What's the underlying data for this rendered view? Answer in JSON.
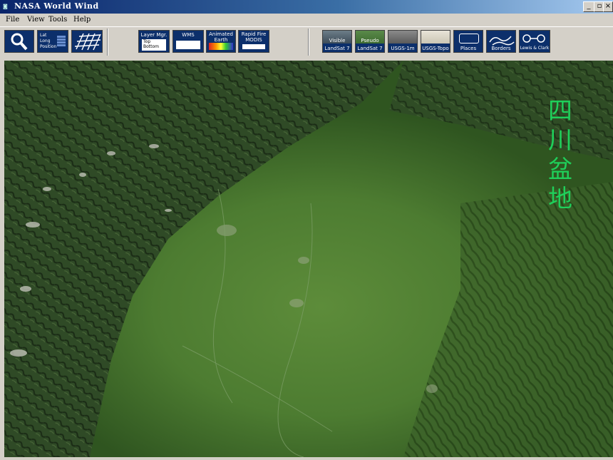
{
  "window": {
    "title": "NASA World Wind",
    "icon": "world-wind-icon",
    "controls": {
      "minimize": "_",
      "restore": "▫",
      "close": "×"
    }
  },
  "menu": {
    "items": [
      "File",
      "View",
      "Tools",
      "Help"
    ]
  },
  "toolbar": {
    "left_tools": [
      {
        "name": "search",
        "icon": "magnifier-icon"
      },
      {
        "name": "position",
        "lines": [
          "Lat",
          "Long",
          "Position"
        ]
      },
      {
        "name": "lat-long-grid",
        "icon": "grid-icon"
      }
    ],
    "layer_mgr": {
      "label": "Layer Mgr.",
      "top": "Top",
      "bottom": "Bottom"
    },
    "wms": {
      "label": "WMS"
    },
    "animated_earth": {
      "label1": "Animated",
      "label2": "Earth"
    },
    "rapid_fire": {
      "label1": "Rapid Fire",
      "label2": "MODIS"
    },
    "layers": [
      {
        "name": "landsat-visible",
        "top": "Visible",
        "label": "LandSat 7"
      },
      {
        "name": "landsat-pseudo",
        "top": "Pseudo",
        "label": "LandSat 7"
      },
      {
        "name": "usgs-1m",
        "top": "",
        "label": "USGS-1m"
      },
      {
        "name": "usgs-topo",
        "top": "",
        "label": "USGS-Topo"
      },
      {
        "name": "places",
        "top": "Places",
        "label": "Places"
      },
      {
        "name": "borders",
        "top": "",
        "label": "Borders"
      },
      {
        "name": "lewis-clark",
        "top": "",
        "label": "Lewis & Clark"
      }
    ]
  },
  "map": {
    "label_chars": [
      "四",
      "川",
      "盆",
      "地"
    ],
    "label_color": "#1fcf5a"
  }
}
